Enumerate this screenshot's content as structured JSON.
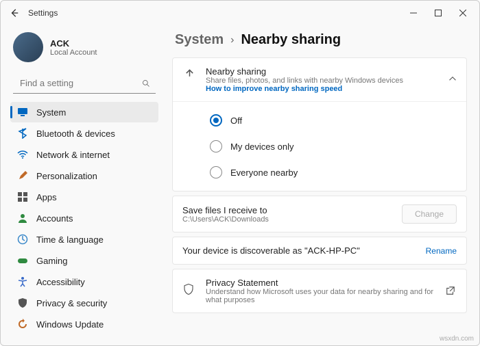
{
  "window": {
    "title": "Settings"
  },
  "user": {
    "name": "ACK",
    "account_type": "Local Account"
  },
  "search": {
    "placeholder": "Find a setting"
  },
  "sidebar": {
    "items": [
      {
        "label": "System",
        "icon_name": "display-icon",
        "icon_color": "#0067c0",
        "selected": true
      },
      {
        "label": "Bluetooth & devices",
        "icon_name": "bluetooth-icon",
        "icon_color": "#0067c0"
      },
      {
        "label": "Network & internet",
        "icon_name": "wifi-icon",
        "icon_color": "#0067c0"
      },
      {
        "label": "Personalization",
        "icon_name": "paintbrush-icon",
        "icon_color": "#c06a28"
      },
      {
        "label": "Apps",
        "icon_name": "apps-icon",
        "icon_color": "#555"
      },
      {
        "label": "Accounts",
        "icon_name": "person-icon",
        "icon_color": "#2f8a40"
      },
      {
        "label": "Time & language",
        "icon_name": "clock-globe-icon",
        "icon_color": "#3a88c9"
      },
      {
        "label": "Gaming",
        "icon_name": "gaming-icon",
        "icon_color": "#2f8a40"
      },
      {
        "label": "Accessibility",
        "icon_name": "accessibility-icon",
        "icon_color": "#3a6bc9"
      },
      {
        "label": "Privacy & security",
        "icon_name": "shield-icon",
        "icon_color": "#555"
      },
      {
        "label": "Windows Update",
        "icon_name": "update-icon",
        "icon_color": "#c06a28"
      }
    ]
  },
  "breadcrumb": {
    "parent": "System",
    "current": "Nearby sharing"
  },
  "nearby_card": {
    "title": "Nearby sharing",
    "subtitle": "Share files, photos, and links with nearby Windows devices",
    "link": "How to improve nearby sharing speed",
    "options": [
      {
        "label": "Off",
        "selected": true
      },
      {
        "label": "My devices only",
        "selected": false
      },
      {
        "label": "Everyone nearby",
        "selected": false
      }
    ]
  },
  "save_row": {
    "title": "Save files I receive to",
    "path": "C:\\Users\\ACK\\Downloads",
    "button": "Change"
  },
  "discover_row": {
    "text": "Your device is discoverable as \"ACK-HP-PC\"",
    "link": "Rename"
  },
  "privacy_row": {
    "title": "Privacy Statement",
    "subtitle": "Understand how Microsoft uses your data for nearby sharing and for what purposes"
  },
  "watermark": "wsxdn.com"
}
